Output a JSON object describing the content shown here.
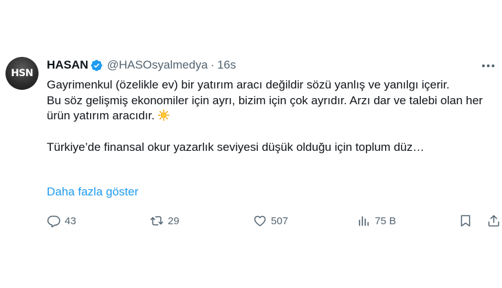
{
  "author": {
    "avatar_text": "HSN",
    "display_name": "HASAN",
    "handle": "@HASOsyalmedya",
    "separator": "·",
    "time": "16s",
    "verified_color": "#1d9bf0"
  },
  "tweet": {
    "paragraph1": "Gayrimenkul (özelikle ev) bir yatırım aracı değildir sözü yanlış ve yanılgı içerir.",
    "paragraph2": "Bu söz gelişmiş ekonomiler için ayrı, bizim için çok ayrıdır. Arzı dar ve talebi olan her ürün yatırım aracıdır.",
    "paragraph2_emoji": "sun-emoji",
    "paragraph3": "Türkiye’de finansal okur yazarlık seviyesi düşük olduğu için toplum düz…",
    "show_more": "Daha fazla göster"
  },
  "actions": {
    "replies": "43",
    "retweets": "29",
    "likes": "507",
    "views": "75 B"
  },
  "colors": {
    "text": "#0f1419",
    "muted": "#536471",
    "accent": "#1d9bf0"
  }
}
